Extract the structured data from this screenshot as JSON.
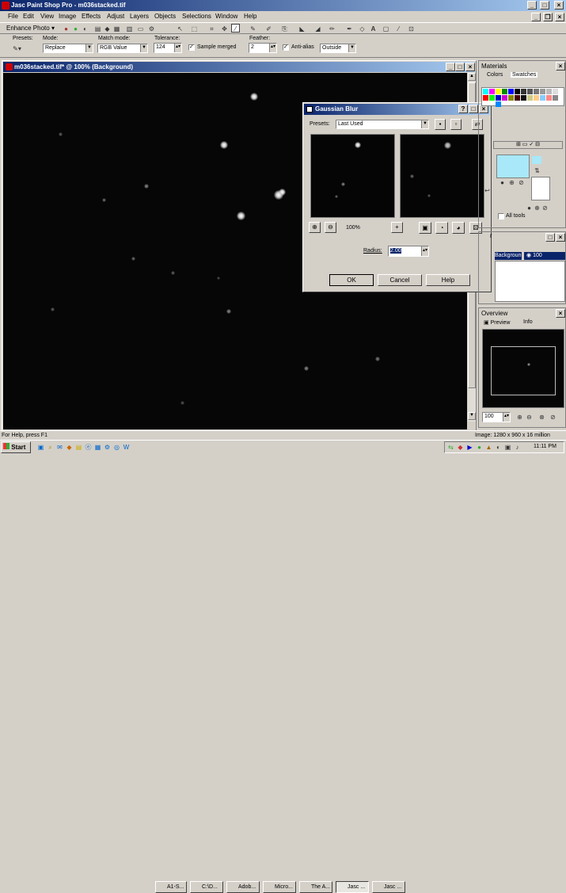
{
  "app": {
    "title": "Jasc Paint Shop Pro - m036stacked.tif"
  },
  "menu": [
    "File",
    "Edit",
    "View",
    "Image",
    "Effects",
    "Adjust",
    "Layers",
    "Objects",
    "Selections",
    "Window",
    "Help"
  ],
  "toolbar": {
    "enhance_photo": "Enhance Photo"
  },
  "options": {
    "presets_label": "Presets:",
    "mode_label": "Mode:",
    "mode_value": "Replace",
    "match_label": "Match mode:",
    "match_value": "RGB Value",
    "tolerance_label": "Tolerance:",
    "tolerance_value": "124",
    "sample_merged": "Sample merged",
    "feather_label": "Feather:",
    "feather_value": "2",
    "antialias": "Anti-alias",
    "outside_value": "Outside"
  },
  "document": {
    "title": "m036stacked.tif* @ 100% (Background)"
  },
  "dialog": {
    "title": "Gaussian Blur",
    "presets_label": "Presets:",
    "presets_value": "Last Used",
    "zoom": "100%",
    "radius_label": "Radius:",
    "radius_value": "2.00",
    "ok": "OK",
    "cancel": "Cancel",
    "help": "Help"
  },
  "materials": {
    "title": "Materials",
    "tab_colors": "Colors",
    "tab_swatches": "Swatches",
    "all_tools": "All tools"
  },
  "layers": {
    "row_name": "Backgroun",
    "row_extra": "100"
  },
  "overview": {
    "title": "Overview",
    "tab_preview": "Preview",
    "tab_info": "Info",
    "zoom": "100"
  },
  "status": {
    "left": "For Help, press F1",
    "right": "Image:  1280 x 960 x 16 million"
  },
  "taskbar": {
    "start": "Start",
    "tasks": [
      "A1-S...",
      "C:\\D...",
      "Adob...",
      "Micro...",
      "The A...",
      "Jasc ...",
      "Jasc ..."
    ],
    "time": "11:11 PM"
  },
  "colors": {
    "title_active": "#0a246a",
    "title_gradient_end": "#a6caf0",
    "foreground": "#a8e8f8"
  }
}
